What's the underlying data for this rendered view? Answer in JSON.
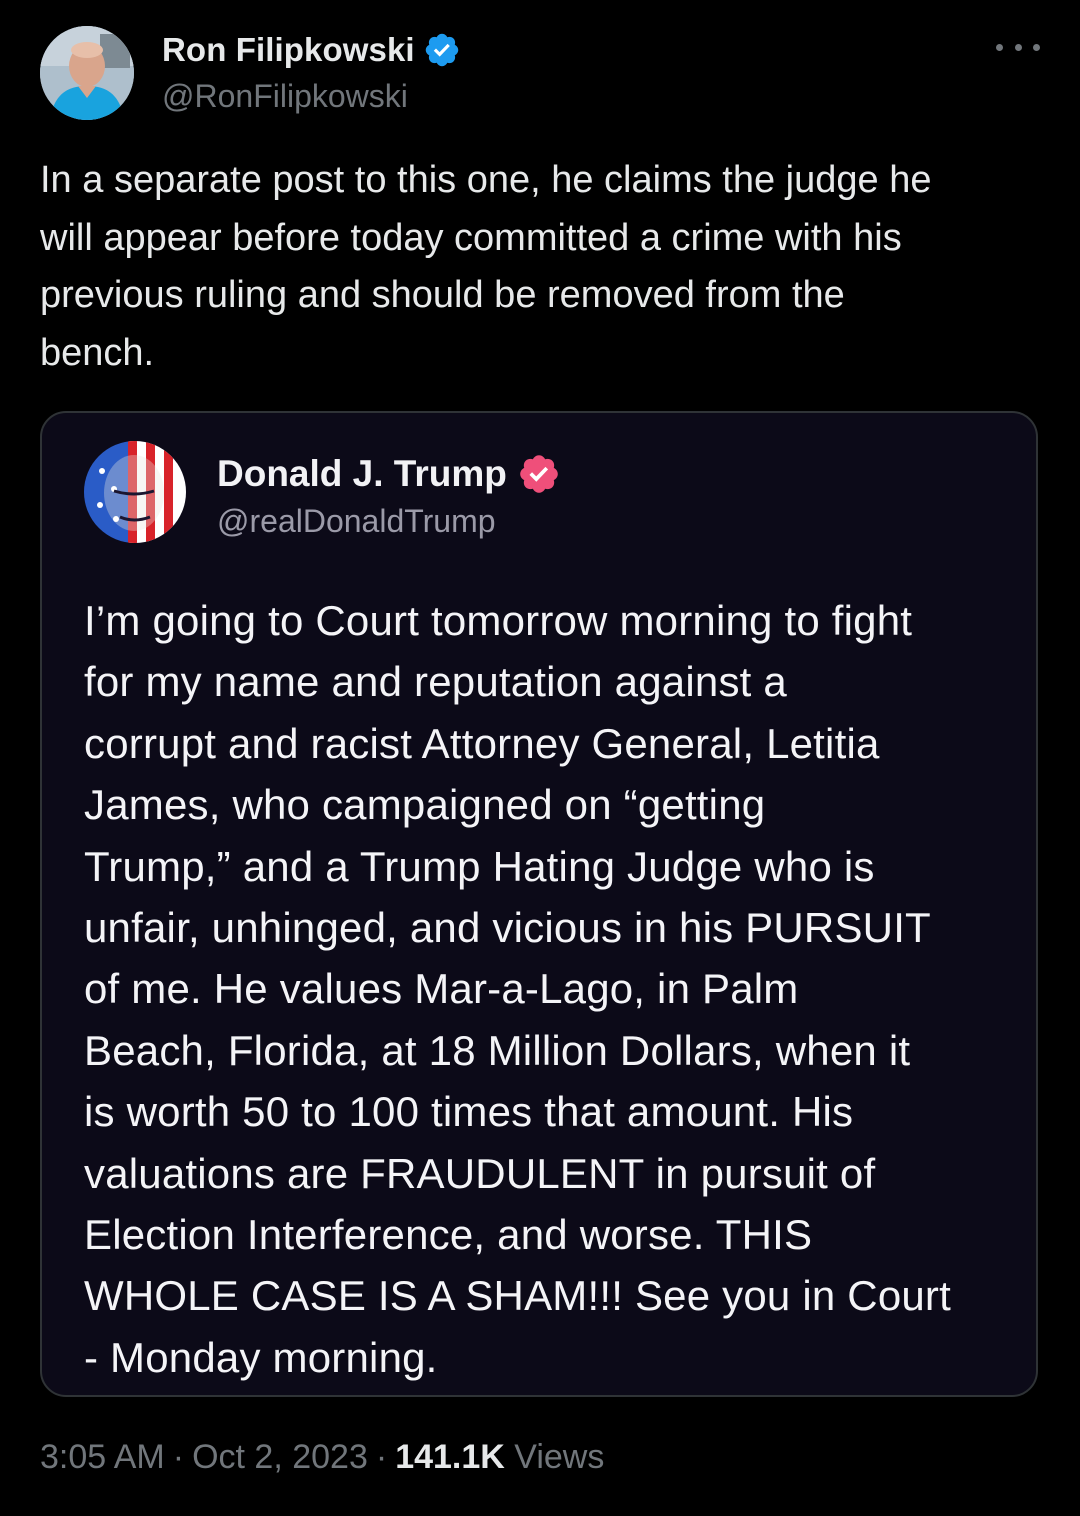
{
  "author": {
    "display_name": "Ron Filipkowski",
    "handle": "@RonFilipkowski",
    "verified_icon": "verified-badge-icon",
    "verified_color": "#1d9bf0"
  },
  "tweet": {
    "text": "In a separate post to this one, he claims the judge he\nwill appear before today committed a crime with his\nprevious ruling and should be removed from the\nbench."
  },
  "quoted_post": {
    "display_name": "Donald J. Trump",
    "handle": "@realDonaldTrump",
    "badge_color": "#ef4f7a",
    "text": "I’m going to Court tomorrow morning to fight\nfor my name and reputation against a\ncorrupt and racist Attorney General, Letitia\nJames, who campaigned on “getting\nTrump,” and a Trump Hating Judge who is\nunfair, unhinged, and vicious in his PURSUIT\nof me. He values Mar-a-Lago, in Palm\nBeach, Florida, at 18 Million Dollars, when it\nis worth 50 to 100 times that amount. His\nvaluations are FRAUDULENT in pursuit of\nElection Interference, and worse. THIS\nWHOLE CASE IS A SHAM!!! See you in Court\n- Monday morning."
  },
  "meta": {
    "time": "3:05 AM",
    "separator": "·",
    "date": "Oct 2, 2023",
    "views_count": "141.1K",
    "views_label": "Views"
  },
  "colors": {
    "background": "#000000",
    "text_primary": "#e7e9ea",
    "text_secondary": "#71767b",
    "quote_background": "#0c0a18",
    "quote_border": "#2f3336"
  }
}
